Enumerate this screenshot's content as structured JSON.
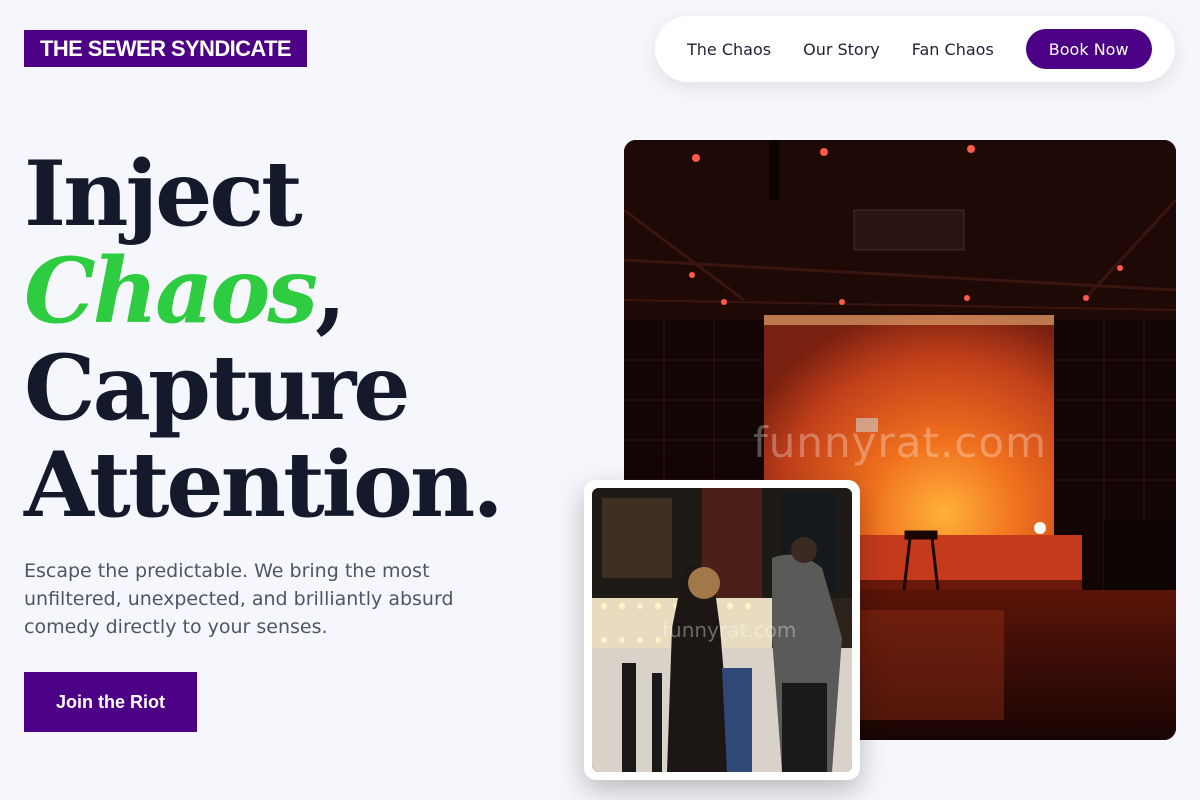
{
  "brand": {
    "name": "THE SEWER SYNDICATE"
  },
  "nav": {
    "links": [
      "The Chaos",
      "Our Story",
      "Fan Chaos"
    ],
    "cta": "Book Now"
  },
  "hero": {
    "headline_line1": "Inject",
    "headline_accent": "Chaos",
    "headline_comma": ",",
    "headline_line3": "Capture",
    "headline_line4": "Attention.",
    "subtext": "Escape the predictable. We bring the most unfiltered, unexpected, and brilliantly absurd comedy directly to your senses.",
    "cta": "Join the Riot"
  },
  "images": {
    "main_watermark": "funnyrat.com",
    "inset_watermark": "funnyrat.com"
  },
  "colors": {
    "brand_purple": "#4b0085",
    "accent_green": "#2ecc40",
    "text_dark": "#141a2c",
    "background": "#f6f7fc"
  }
}
